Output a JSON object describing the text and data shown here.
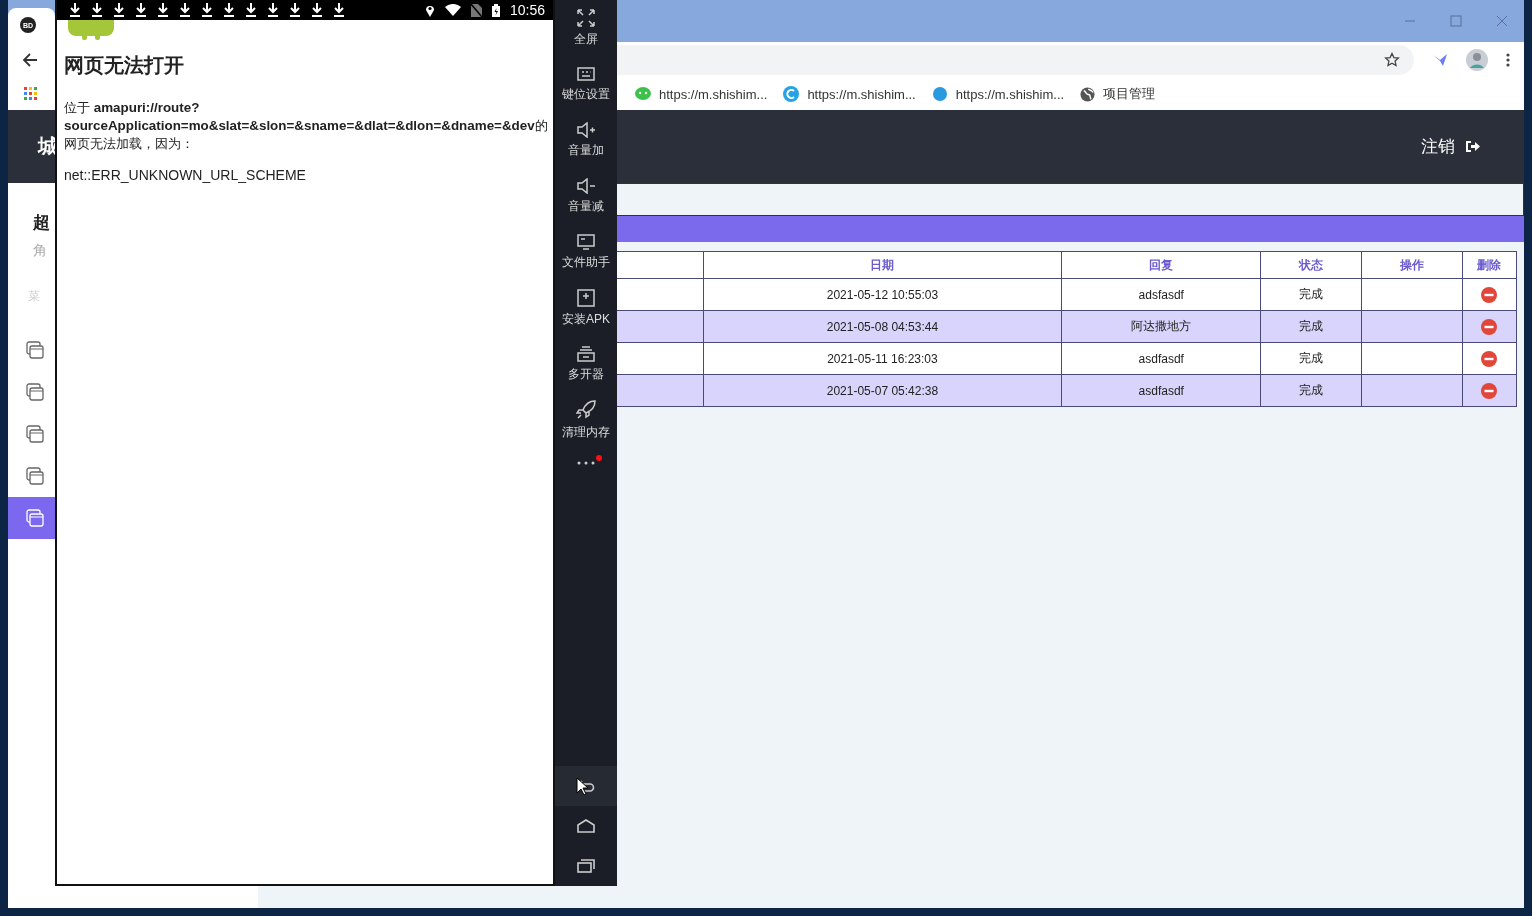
{
  "browser": {
    "tab": {
      "icon_text": "BD"
    },
    "bookmarks": [
      {
        "label": "https://m.shishim..."
      },
      {
        "label": "https://m.shishim..."
      },
      {
        "label": "https://m.shishim..."
      },
      {
        "label": "项目管理"
      }
    ],
    "page": {
      "header": {
        "brand": "城",
        "logout": "注销"
      },
      "sidebar": {
        "user_name": "超",
        "role": "角",
        "menu_heading": "菜",
        "items": [
          {
            "selected": false
          },
          {
            "selected": false
          },
          {
            "selected": false
          },
          {
            "selected": false
          },
          {
            "selected": true
          }
        ]
      },
      "table": {
        "columns": [
          "",
          "日期",
          "回复",
          "状态",
          "操作",
          "删除"
        ],
        "rows": [
          {
            "date": "2021-05-12 10:55:03",
            "reply": "adsfasdf",
            "status": "完成"
          },
          {
            "date": "2021-05-08 04:53:44",
            "reply": "阿达撒地方",
            "status": "完成"
          },
          {
            "date": "2021-05-11 16:23:03",
            "reply": "asdfasdf",
            "status": "完成"
          },
          {
            "date": "2021-05-07 05:42:38",
            "reply": "asdfasdf",
            "status": "完成"
          }
        ]
      }
    }
  },
  "emulator": {
    "status_bar": {
      "time": "10:56"
    },
    "error_page": {
      "title": "网页无法打开",
      "message": "位于 **amapuri://route?sourceApplication=mo&slat=&slon=&sname=&dlat=&dlon=&dname=&dev**的网页无法加载，因为：",
      "error_code": "net::ERR_UNKNOWN_URL_SCHEME"
    },
    "tools": [
      {
        "label": "全屏"
      },
      {
        "label": "键位设置"
      },
      {
        "label": "音量加"
      },
      {
        "label": "音量减"
      },
      {
        "label": "文件助手"
      },
      {
        "label": "安装APK"
      },
      {
        "label": "多开器"
      },
      {
        "label": "清理内存"
      }
    ],
    "more": {
      "has_notification": true
    },
    "nav_buttons": [
      {
        "hovered": true
      },
      {
        "hovered": false
      },
      {
        "hovered": false
      }
    ]
  }
}
